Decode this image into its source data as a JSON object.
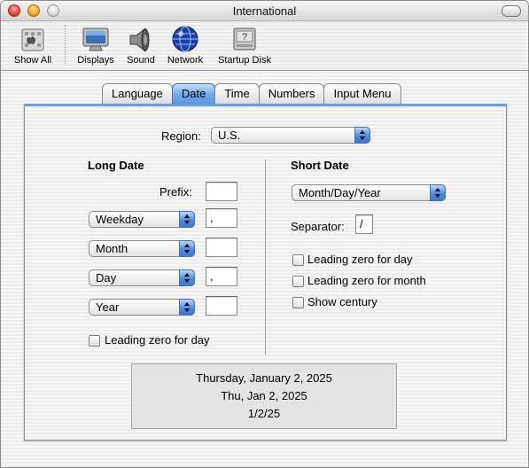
{
  "window": {
    "title": "International"
  },
  "toolbar": {
    "items": [
      {
        "label": "Show All",
        "icon": "show-all-icon"
      },
      {
        "label": "Displays",
        "icon": "display-icon"
      },
      {
        "label": "Sound",
        "icon": "speaker-icon"
      },
      {
        "label": "Network",
        "icon": "globe-icon"
      },
      {
        "label": "Startup Disk",
        "icon": "disk-icon"
      }
    ]
  },
  "tabs": [
    {
      "label": "Language",
      "selected": false
    },
    {
      "label": "Date",
      "selected": true
    },
    {
      "label": "Time",
      "selected": false
    },
    {
      "label": "Numbers",
      "selected": false
    },
    {
      "label": "Input Menu",
      "selected": false
    }
  ],
  "region": {
    "label": "Region:",
    "value": "U.S."
  },
  "long_date": {
    "heading": "Long Date",
    "prefix_label": "Prefix:",
    "prefix_value": "",
    "rows": [
      {
        "popup": "Weekday",
        "separator": ","
      },
      {
        "popup": "Month",
        "separator": ""
      },
      {
        "popup": "Day",
        "separator": ","
      },
      {
        "popup": "Year",
        "separator": ""
      }
    ],
    "leading_zero_label": "Leading zero for day",
    "leading_zero_checked": false
  },
  "short_date": {
    "heading": "Short Date",
    "format": "Month/Day/Year",
    "separator_label": "Separator:",
    "separator_value": "/",
    "options": [
      {
        "label": "Leading zero for day",
        "checked": false
      },
      {
        "label": "Leading zero for month",
        "checked": false
      },
      {
        "label": "Show century",
        "checked": false
      }
    ]
  },
  "preview": {
    "long": "Thursday, January 2, 2025",
    "medium": "Thu, Jan 2, 2025",
    "short": "1/2/25"
  },
  "colors": {
    "accent_blue": "#5a97e2",
    "panel_top_border": "#6d9fd6"
  }
}
